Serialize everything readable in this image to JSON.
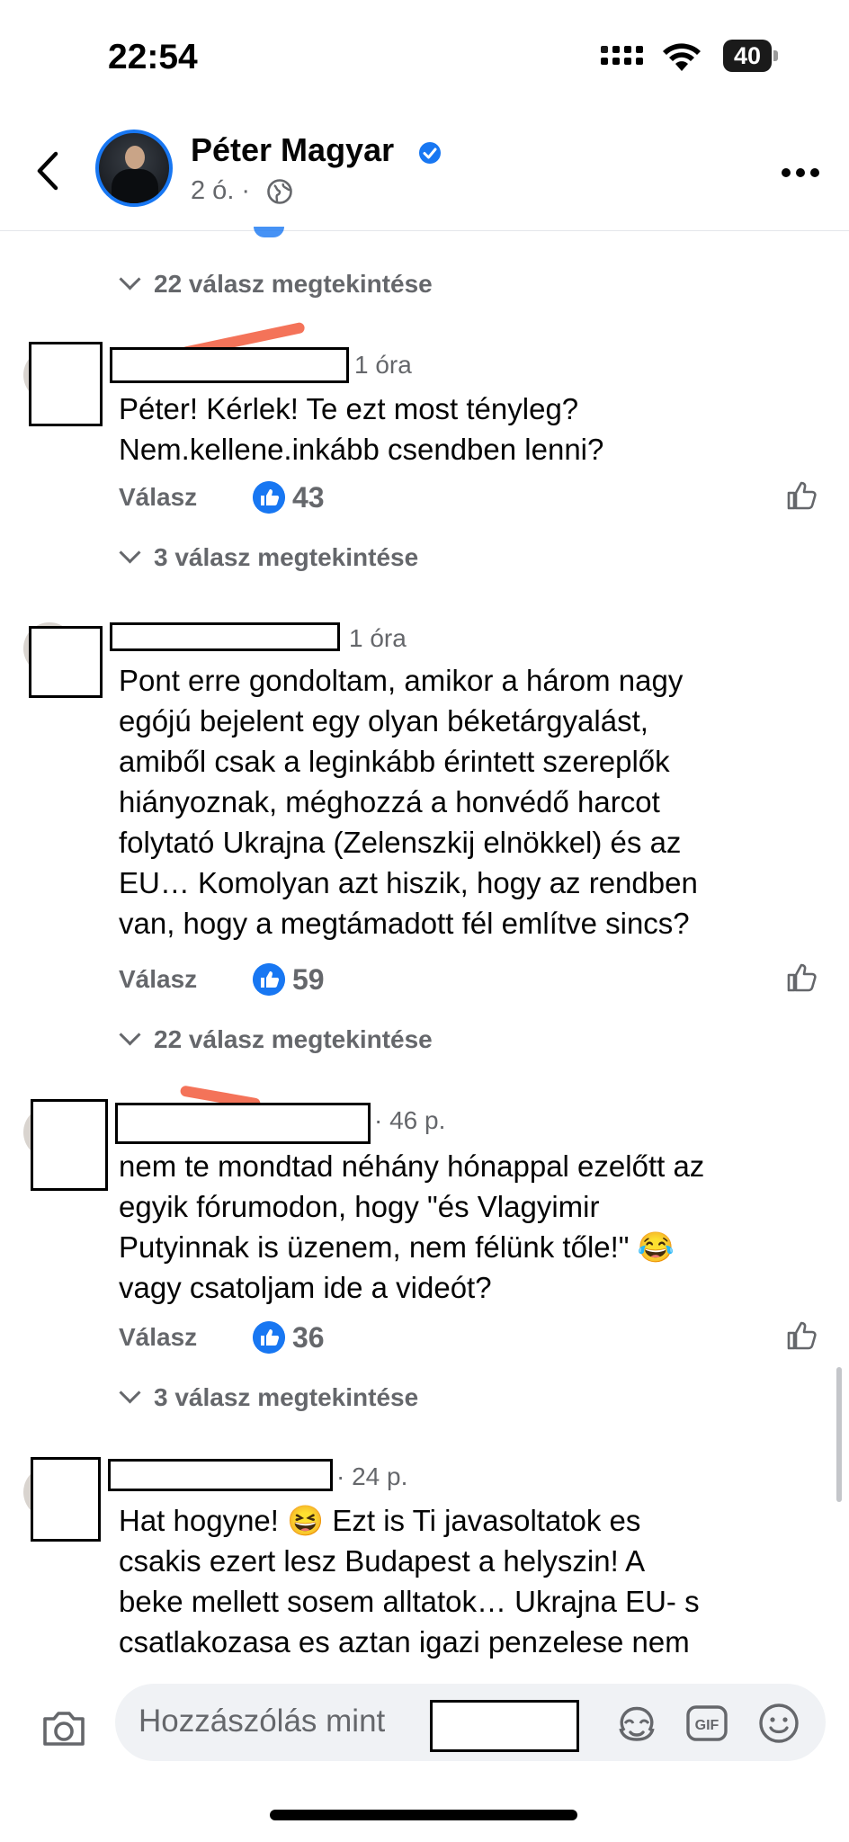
{
  "status_bar": {
    "time": "22:54",
    "battery": "40"
  },
  "header": {
    "back_icon": "chevron-left-icon",
    "title": "Péter Magyar",
    "age": "2 ó. ·",
    "more_icon": "more-icon"
  },
  "comments": [
    {
      "time": "1 óra",
      "text": [
        "Péter! Kérlek! Te ezt most tényleg?",
        "Nem.kellene.inkább csendben lenni?"
      ],
      "reply_label": "Válasz",
      "likes": "43",
      "view_replies": "3 válasz megtekintése"
    },
    {
      "time": "1 óra",
      "text": [
        "Pont erre gondoltam, amikor a három nagy",
        "egójú bejelent egy olyan béketárgyalást,",
        "amiből csak a leginkább érintett szereplők",
        "hiányoznak, méghozzá a honvédő harcot",
        "folytató Ukrajna (Zelenszkij elnökkel) és az",
        "EU… Komolyan azt hiszik, hogy az rendben",
        "van, hogy a megtámadott fél említve sincs?"
      ],
      "reply_label": "Válasz",
      "likes": "59",
      "view_replies": "22 válasz megtekintése"
    },
    {
      "time": "· 46 p.",
      "text": [
        "nem te mondtad néhány hónappal ezelőtt az",
        "egyik fórumodon, hogy \"és Vlagyimir",
        "Putyinnak is üzenem, nem félünk tőle!\" 😂",
        "vagy csatoljam ide a videót?"
      ],
      "reply_label": "Válasz",
      "likes": "36",
      "view_replies": "3 válasz megtekintése"
    },
    {
      "time": "· 24 p.",
      "text": [
        "Hat hogyne! 😆 Ezt is Ti javasoltatok es",
        "csakis ezert lesz Budapest a helyszin! A",
        "beke mellett sosem alltatok… Ukrajna EU- s",
        "csatlakozasa es aztan igazi penzelese nem"
      ]
    }
  ],
  "top_view_replies": "22 válasz megtekintése",
  "composer": {
    "placeholder": "Hozzászólás mint",
    "icons": [
      "camera-icon",
      "avatar-sticker-icon",
      "gif-icon",
      "emoji-icon"
    ]
  }
}
